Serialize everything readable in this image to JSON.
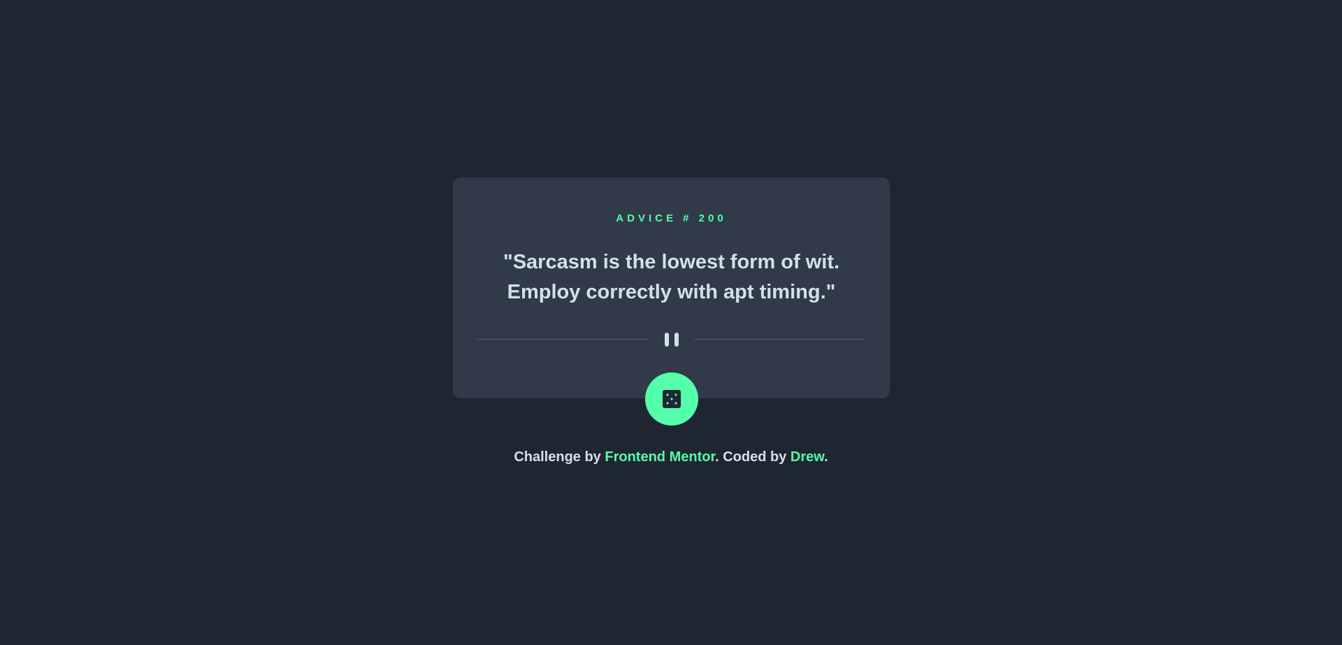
{
  "card": {
    "advice_label": "ADVICE # 200",
    "quote_line1": "\"Sarcasm is the lowest form of wit.",
    "quote_line2": "Employ correctly with apt timing.\""
  },
  "icons": {
    "divider": "pause-icon",
    "button": "dice-icon"
  },
  "footer": {
    "prefix": "Challenge by ",
    "challenge_link": "Frontend Mentor",
    "middle": ". Coded by ",
    "author_link": "Drew",
    "suffix": "."
  },
  "colors": {
    "background": "#1f2632",
    "card": "#313a48",
    "accent": "#53ffaa",
    "text": "#cee3e9",
    "divider": "#4f5b6b"
  }
}
